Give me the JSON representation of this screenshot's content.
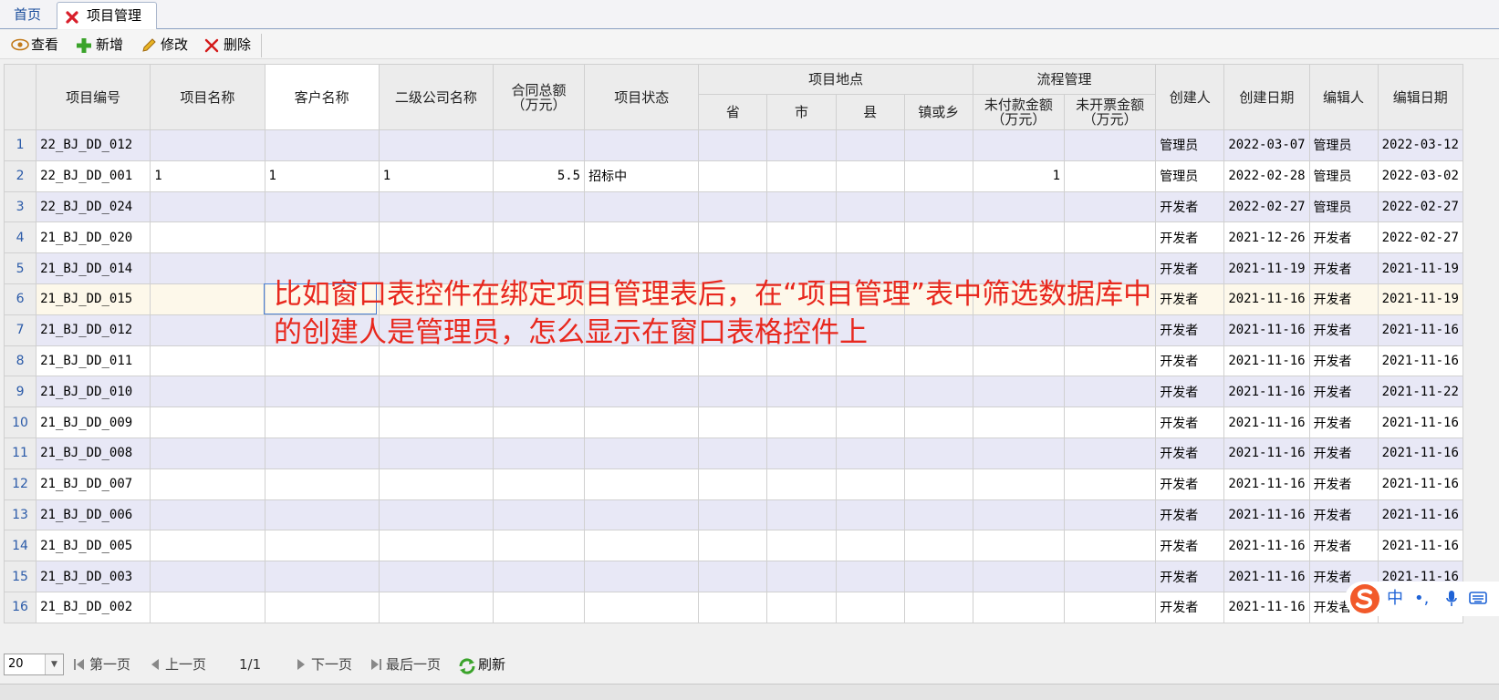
{
  "tabs": {
    "home": "首页",
    "active": "项目管理"
  },
  "toolbar": {
    "view": "查看",
    "add": "新增",
    "edit": "修改",
    "delete": "删除"
  },
  "table": {
    "headers": {
      "project_no": "项目编号",
      "project_name": "项目名称",
      "customer_name": "客户名称",
      "sub_company": "二级公司名称",
      "contract_total": "合同总额\n（万元）",
      "project_status": "项目状态",
      "location_group": "项目地点",
      "province": "省",
      "city": "市",
      "county": "县",
      "town": "镇或乡",
      "process_group": "流程管理",
      "unpaid": "未付款金额\n（万元）",
      "uninvoiced": "未开票金额\n（万元）",
      "creator": "创建人",
      "created_date": "创建日期",
      "editor": "编辑人",
      "edited_date": "编辑日期"
    },
    "rows": [
      {
        "n": "1",
        "no": "22_BJ_DD_012",
        "name": "",
        "cust": "",
        "sub": "",
        "total": "",
        "status": "",
        "unpaid": "",
        "creator": "管理员",
        "cdate": "2022-03-07",
        "editor": "管理员",
        "edate": "2022-03-12"
      },
      {
        "n": "2",
        "no": "22_BJ_DD_001",
        "name": "1",
        "cust": "1",
        "sub": "1",
        "total": "5.5",
        "status": "招标中",
        "unpaid": "1",
        "creator": "管理员",
        "cdate": "2022-02-28",
        "editor": "管理员",
        "edate": "2022-03-02"
      },
      {
        "n": "3",
        "no": "22_BJ_DD_024",
        "name": "",
        "cust": "",
        "sub": "",
        "total": "",
        "status": "",
        "unpaid": "",
        "creator": "开发者",
        "cdate": "2022-02-27",
        "editor": "管理员",
        "edate": "2022-02-27"
      },
      {
        "n": "4",
        "no": "21_BJ_DD_020",
        "name": "",
        "cust": "",
        "sub": "",
        "total": "",
        "status": "",
        "unpaid": "",
        "creator": "开发者",
        "cdate": "2021-12-26",
        "editor": "开发者",
        "edate": "2022-02-27"
      },
      {
        "n": "5",
        "no": "21_BJ_DD_014",
        "name": "",
        "cust": "",
        "sub": "",
        "total": "",
        "status": "",
        "unpaid": "",
        "creator": "开发者",
        "cdate": "2021-11-19",
        "editor": "开发者",
        "edate": "2021-11-19"
      },
      {
        "n": "6",
        "no": "21_BJ_DD_015",
        "name": "",
        "cust": "",
        "sub": "",
        "total": "",
        "status": "",
        "unpaid": "",
        "creator": "开发者",
        "cdate": "2021-11-16",
        "editor": "开发者",
        "edate": "2021-11-19"
      },
      {
        "n": "7",
        "no": "21_BJ_DD_012",
        "name": "",
        "cust": "",
        "sub": "",
        "total": "",
        "status": "",
        "unpaid": "",
        "creator": "开发者",
        "cdate": "2021-11-16",
        "editor": "开发者",
        "edate": "2021-11-16"
      },
      {
        "n": "8",
        "no": "21_BJ_DD_011",
        "name": "",
        "cust": "",
        "sub": "",
        "total": "",
        "status": "",
        "unpaid": "",
        "creator": "开发者",
        "cdate": "2021-11-16",
        "editor": "开发者",
        "edate": "2021-11-16"
      },
      {
        "n": "9",
        "no": "21_BJ_DD_010",
        "name": "",
        "cust": "",
        "sub": "",
        "total": "",
        "status": "",
        "unpaid": "",
        "creator": "开发者",
        "cdate": "2021-11-16",
        "editor": "开发者",
        "edate": "2021-11-22"
      },
      {
        "n": "10",
        "no": "21_BJ_DD_009",
        "name": "",
        "cust": "",
        "sub": "",
        "total": "",
        "status": "",
        "unpaid": "",
        "creator": "开发者",
        "cdate": "2021-11-16",
        "editor": "开发者",
        "edate": "2021-11-16"
      },
      {
        "n": "11",
        "no": "21_BJ_DD_008",
        "name": "",
        "cust": "",
        "sub": "",
        "total": "",
        "status": "",
        "unpaid": "",
        "creator": "开发者",
        "cdate": "2021-11-16",
        "editor": "开发者",
        "edate": "2021-11-16"
      },
      {
        "n": "12",
        "no": "21_BJ_DD_007",
        "name": "",
        "cust": "",
        "sub": "",
        "total": "",
        "status": "",
        "unpaid": "",
        "creator": "开发者",
        "cdate": "2021-11-16",
        "editor": "开发者",
        "edate": "2021-11-16"
      },
      {
        "n": "13",
        "no": "21_BJ_DD_006",
        "name": "",
        "cust": "",
        "sub": "",
        "total": "",
        "status": "",
        "unpaid": "",
        "creator": "开发者",
        "cdate": "2021-11-16",
        "editor": "开发者",
        "edate": "2021-11-16"
      },
      {
        "n": "14",
        "no": "21_BJ_DD_005",
        "name": "",
        "cust": "",
        "sub": "",
        "total": "",
        "status": "",
        "unpaid": "",
        "creator": "开发者",
        "cdate": "2021-11-16",
        "editor": "开发者",
        "edate": "2021-11-16"
      },
      {
        "n": "15",
        "no": "21_BJ_DD_003",
        "name": "",
        "cust": "",
        "sub": "",
        "total": "",
        "status": "",
        "unpaid": "",
        "creator": "开发者",
        "cdate": "2021-11-16",
        "editor": "开发者",
        "edate": "2021-11-16"
      },
      {
        "n": "16",
        "no": "21_BJ_DD_002",
        "name": "",
        "cust": "",
        "sub": "",
        "total": "",
        "status": "",
        "unpaid": "",
        "creator": "开发者",
        "cdate": "2021-11-16",
        "editor": "开发者",
        "edate": ""
      }
    ]
  },
  "annotation": "比如窗口表控件在绑定项目管理表后，在“项目管理”表中筛选数据库中的创建人是管理员，怎么显示在窗口表格控件上",
  "pager": {
    "page_size": "20",
    "first": "第一页",
    "prev": "上一页",
    "page_info": "1/1",
    "next": "下一页",
    "last": "最后一页",
    "refresh": "刷新"
  },
  "ime": {
    "mode": "中",
    "punct": "•,",
    "mic": "mic-icon",
    "keyboard": "keyboard-icon"
  },
  "colors": {
    "annotation": "#e8281e",
    "link_blue": "#1a4d9c",
    "row_alt": "#e8e8f6",
    "row_highlight": "#fdf8ea"
  }
}
